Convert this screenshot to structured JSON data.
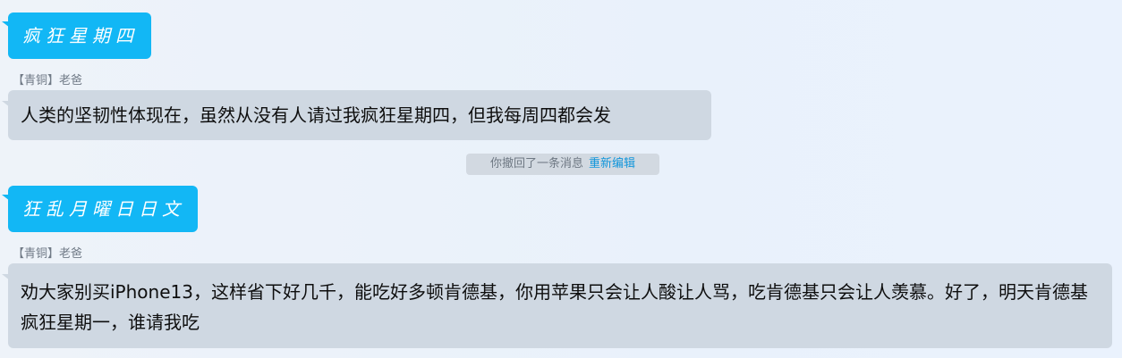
{
  "messages": [
    {
      "type": "self",
      "text": "疯狂星期四"
    },
    {
      "type": "other",
      "sender_badge": "【青铜】",
      "sender_name": "老爸",
      "text": "人类的坚韧性体现在，虽然从没有人请过我疯狂星期四，但我每周四都会发"
    },
    {
      "type": "self",
      "text": "狂乱月曜日日文"
    },
    {
      "type": "other",
      "sender_badge": "【青铜】",
      "sender_name": "老爸",
      "text": "劝大家别买iPhone13，这样省下好几千，能吃好多顿肯德基，你用苹果只会让人酸让人骂，吃肯德基只会让人羡慕。好了，明天肯德基疯狂星期一，谁请我吃"
    }
  ],
  "recall_notice": {
    "text": "你撤回了一条消息",
    "action": "重新编辑"
  },
  "colors": {
    "self_bubble": "#12b7f5",
    "other_bubble": "#cfd8e2",
    "link": "#1296db"
  }
}
